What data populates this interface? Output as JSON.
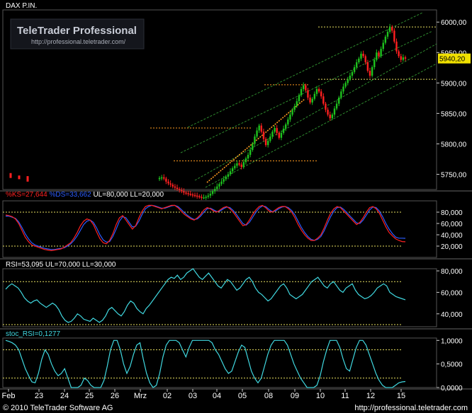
{
  "header": {
    "instrument": "DAX P.IN.",
    "brand": "TeleTrader Professional",
    "brand_url": "http://professional.teletrader.com/"
  },
  "footer": {
    "copyright": "© 2010 TeleTrader Software AG",
    "url": "http://professional.teletrader.com"
  },
  "colors": {
    "background": "#000000",
    "up_candle": "#1ec21e",
    "down_candle": "#ff2020",
    "reference_line": "#e8e060",
    "channel": "#2e8a2e",
    "support_line": "#ff9a20",
    "stoch_k": "#ff2020",
    "stoch_d": "#2b5cff",
    "rsi": "#40d8e0",
    "axis_text": "#ffffff"
  },
  "chart_data": [
    {
      "type": "candlestick",
      "title": "DAX P.IN.",
      "ylim": [
        5725,
        6020
      ],
      "ticks": [
        "5750,00",
        "5800,00",
        "5850,00",
        "5900,00",
        "5950,00",
        "6000,00"
      ],
      "last_value_label": "5940,20",
      "x_tick_labels": [
        "Feb",
        "23",
        "24",
        "25",
        "26",
        "Mrz",
        "02",
        "03",
        "04",
        "05",
        "08",
        "09",
        "10",
        "11",
        "12",
        "15"
      ],
      "close": [
        5744,
        5745,
        5743,
        5738,
        5735,
        5733,
        5730,
        5728,
        5726,
        5724,
        5722,
        5720,
        5719,
        5718,
        5717,
        5716,
        5715,
        5714,
        5713,
        5712,
        5712,
        5713,
        5715,
        5718,
        5722,
        5726,
        5730,
        5734,
        5738,
        5742,
        5746,
        5750,
        5755,
        5760,
        5764,
        5768,
        5766,
        5762,
        5770,
        5776,
        5782,
        5790,
        5800,
        5812,
        5822,
        5830,
        5820,
        5808,
        5798,
        5805,
        5812,
        5820,
        5826,
        5818,
        5810,
        5818,
        5825,
        5832,
        5840,
        5848,
        5856,
        5862,
        5870,
        5880,
        5890,
        5896,
        5888,
        5876,
        5868,
        5874,
        5882,
        5890,
        5886,
        5878,
        5866,
        5856,
        5848,
        5842,
        5848,
        5858,
        5866,
        5876,
        5886,
        5894,
        5900,
        5906,
        5912,
        5918,
        5926,
        5934,
        5940,
        5948,
        5944,
        5934,
        5920,
        5912,
        5926,
        5938,
        5950,
        5944,
        5956,
        5966,
        5976,
        5984,
        5992,
        5986,
        5968,
        5952,
        5944,
        5938,
        5942,
        5940
      ],
      "candle_direction_note": "green = up, red = down",
      "reference_lines": [
        5992,
        5906,
        5897,
        5826,
        5772
      ],
      "series": [
        {
          "name": "%KS",
          "last_value": "27,644",
          "ul": "80,000",
          "ll": "20,000",
          "ylim": [
            0,
            100
          ],
          "ticks": [
            "20,000",
            "40,000",
            "60,000",
            "80,000"
          ],
          "values": [
            75,
            74,
            72,
            68,
            60,
            48,
            36,
            28,
            22,
            20,
            18,
            16,
            14,
            13,
            12,
            13,
            14,
            15,
            18,
            22,
            26,
            34,
            44,
            56,
            64,
            68,
            66,
            58,
            45,
            33,
            26,
            24,
            30,
            42,
            58,
            70,
            74,
            66,
            58,
            50,
            56,
            70,
            82,
            90,
            92,
            92,
            90,
            88,
            86,
            88,
            90,
            92,
            92,
            88,
            82,
            76,
            72,
            68,
            66,
            70,
            76,
            84,
            88,
            86,
            82,
            80,
            84,
            88,
            90,
            86,
            80,
            72,
            64,
            56,
            58,
            66,
            76,
            84,
            90,
            92,
            88,
            82,
            80,
            84,
            88,
            90,
            90,
            86,
            80,
            70,
            58,
            48,
            40,
            34,
            30,
            30,
            34,
            40,
            52,
            66,
            78,
            86,
            90,
            88,
            82,
            76,
            70,
            64,
            58,
            62,
            70,
            80,
            88,
            90,
            86,
            78,
            66,
            54,
            44,
            38,
            33,
            30,
            28,
            27.6
          ]
        },
        {
          "name": "%DS",
          "last_value": "33,662",
          "values": [
            73,
            73,
            71,
            69,
            63,
            53,
            42,
            33,
            26,
            22,
            20,
            18,
            16,
            15,
            14,
            14,
            15,
            16,
            17,
            20,
            24,
            30,
            38,
            48,
            58,
            64,
            66,
            62,
            52,
            40,
            31,
            27,
            28,
            37,
            50,
            64,
            72,
            70,
            62,
            54,
            55,
            64,
            76,
            86,
            90,
            92,
            91,
            89,
            87,
            87,
            89,
            91,
            92,
            90,
            85,
            79,
            74,
            70,
            67,
            68,
            73,
            80,
            86,
            87,
            84,
            81,
            82,
            86,
            89,
            88,
            83,
            76,
            68,
            60,
            57,
            62,
            71,
            80,
            87,
            91,
            90,
            85,
            81,
            82,
            86,
            89,
            90,
            88,
            83,
            75,
            64,
            53,
            44,
            37,
            32,
            30,
            32,
            37,
            47,
            60,
            72,
            82,
            88,
            89,
            85,
            79,
            73,
            67,
            61,
            60,
            66,
            75,
            84,
            89,
            88,
            82,
            72,
            60,
            50,
            42,
            36,
            34,
            34,
            33.7
          ]
        },
        {
          "name": "RSI",
          "last_value": "53,095",
          "ul": "70,000",
          "ll": "30,000",
          "ylim": [
            28,
            82
          ],
          "ticks": [
            "40,000",
            "60,000",
            "80,000"
          ],
          "values": [
            63,
            66,
            68,
            66,
            64,
            60,
            55,
            52,
            50,
            52,
            53,
            50,
            48,
            46,
            48,
            50,
            48,
            44,
            38,
            34,
            32,
            33,
            36,
            40,
            38,
            35,
            34,
            33,
            36,
            34,
            32,
            34,
            38,
            44,
            46,
            43,
            40,
            38,
            42,
            48,
            52,
            50,
            45,
            42,
            40,
            45,
            48,
            52,
            56,
            60,
            64,
            68,
            72,
            74,
            73,
            76,
            72,
            74,
            78,
            80,
            82,
            78,
            74,
            72,
            75,
            78,
            74,
            70,
            66,
            64,
            68,
            72,
            70,
            66,
            62,
            64,
            68,
            72,
            74,
            70,
            64,
            60,
            58,
            55,
            52,
            54,
            58,
            62,
            66,
            68,
            64,
            58,
            56,
            54,
            56,
            58,
            62,
            66,
            70,
            72,
            74,
            70,
            66,
            64,
            68,
            70,
            66,
            62,
            60,
            64,
            66,
            68,
            62,
            58,
            56,
            54,
            55,
            57,
            60,
            64,
            66,
            68,
            66,
            60,
            58,
            56,
            55,
            54,
            53.1
          ]
        },
        {
          "name": "stoc_RSI",
          "last_value": "0,1277",
          "ylim": [
            0,
            1.05
          ],
          "ticks": [
            "0,0000",
            "0,5000",
            "1,0000"
          ],
          "values": [
            1,
            0.98,
            0.95,
            0.9,
            0.8,
            0.6,
            0.4,
            0.25,
            0.12,
            0.1,
            0.3,
            0.6,
            0.8,
            0.7,
            0.5,
            0.35,
            0.25,
            0.3,
            0.4,
            0.2,
            0,
            0,
            0,
            0.05,
            0.2,
            0.15,
            0.05,
            0,
            0,
            0,
            0.15,
            0.45,
            0.8,
            1,
            1,
            0.8,
            0.5,
            0.3,
            0.45,
            0.7,
            0.9,
            0.95,
            0.6,
            0.3,
            0.1,
            0,
            0.05,
            0.3,
            0.65,
            0.9,
            1,
            1,
            1,
            0.95,
            0.8,
            0.65,
            0.85,
            1,
            1,
            1,
            1,
            1,
            1,
            0.95,
            0.8,
            0.7,
            0.55,
            0.4,
            0.3,
            0.35,
            0.55,
            0.75,
            0.9,
            0.85,
            0.6,
            0.35,
            0.2,
            0.1,
            0.2,
            0.45,
            0.7,
            0.9,
            1,
            1,
            1,
            1,
            0.9,
            0.7,
            0.5,
            0.35,
            0.2,
            0.1,
            0,
            0,
            0,
            0.05,
            0.25,
            0.55,
            0.8,
            1,
            1,
            1,
            0.85,
            0.6,
            0.4,
            0.35,
            0.6,
            0.85,
            1,
            1,
            0.9,
            0.7,
            0.5,
            0.3,
            0.15,
            0.05,
            0,
            0,
            0,
            0.05,
            0.1,
            0.12,
            0.1277
          ]
        }
      ]
    }
  ]
}
